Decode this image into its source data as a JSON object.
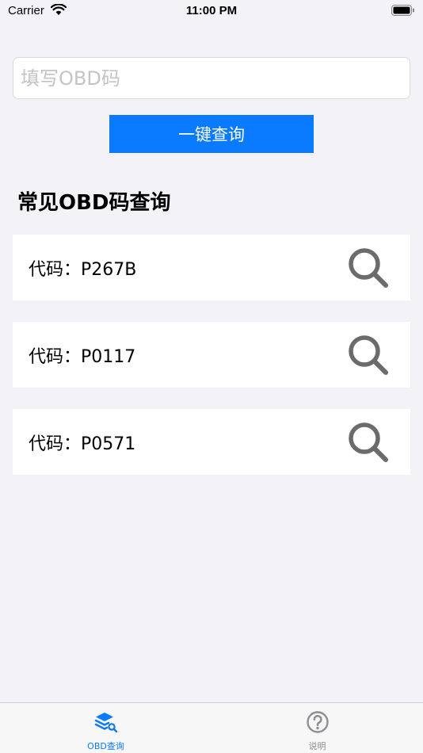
{
  "status_bar": {
    "carrier": "Carrier",
    "time": "11:00 PM"
  },
  "search": {
    "placeholder": "填写OBD码",
    "value": ""
  },
  "query_button": {
    "label": "一键查询"
  },
  "common_section": {
    "title": "常见OBD码查询",
    "items": [
      {
        "label": "代码：P267B"
      },
      {
        "label": "代码：P0117"
      },
      {
        "label": "代码：P0571"
      }
    ]
  },
  "tab_bar": {
    "tabs": [
      {
        "label": "OBD查询",
        "icon": "layers-search-icon",
        "active": true
      },
      {
        "label": "说明",
        "icon": "question-circle-icon",
        "active": false
      }
    ]
  },
  "colors": {
    "accent": "#0a7aff",
    "background": "#f2f2f7",
    "card": "#ffffff",
    "icon_gray": "#6b6b6b",
    "inactive": "#8e8e93"
  }
}
